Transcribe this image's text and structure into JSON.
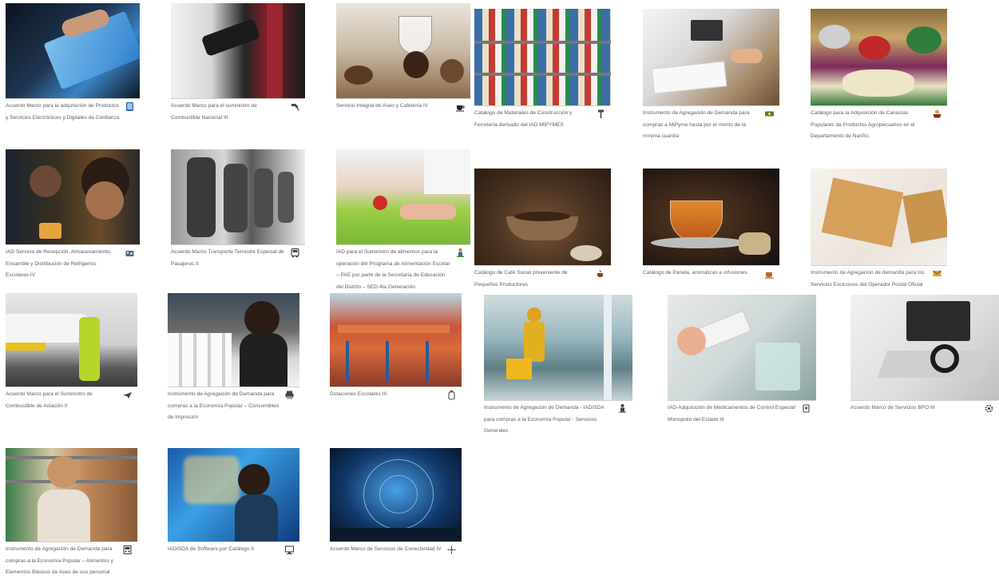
{
  "catalog": {
    "items": [
      {
        "label": "Acuerdo Marco para la adquisición de Productos y Servicios Electrónicos y Digitales de Confianza",
        "icon": "tablet-icon"
      },
      {
        "label": "Acuerdo Marco para el suministro de Combustible Nacional III",
        "icon": "fuel-nozzle-icon"
      },
      {
        "label": "Servicio Integral de Aseo y Cafetería IV",
        "icon": "coffee-cup-icon"
      },
      {
        "label": "Catálogo de Materiales de Construcción y Ferretería derivado del IAD MIPYMES",
        "icon": "hammer-icon"
      },
      {
        "label": "Instrumento de Agregación de Demanda para compras a MiPyme hasta por el monto de la mínima cuantía",
        "icon": "money-icon"
      },
      {
        "label": "Catálogo para la Adquisición de Canastas Populares de Productos Agropecuarios en el Departamento de Nariño.",
        "icon": "basket-icon"
      },
      {
        "label": "IAD Servicio de Recepción, Almacenamiento, Ensamble y Distribución de Refrigerios Escolares IV",
        "icon": "food-tray-icon"
      },
      {
        "label": "Acuerdo Marco Transporte Terrestre Especial de Pasajeros II",
        "icon": "bus-icon"
      },
      {
        "label": "IAD para el Suministro de alimentos para la operación del Programa de Alimentación Escolar – PAE por parte de la Secretaría de Educación del Distrito – SED 4ta Generación",
        "icon": "school-meal-icon"
      },
      {
        "label": "Catálogo de Café Social proveniente de Pequeños Productores",
        "icon": "coffee-icon"
      },
      {
        "label": "Catálogo de Panela, aromáticas e infusiones",
        "icon": "tea-icon"
      },
      {
        "label": "Instrumento de Agregación de demanda para los Servicios Exclusivos del Operador Postal Oficial",
        "icon": "mail-icon"
      },
      {
        "label": "Acuerdo Marco para el Suministro de Combustible de Aviación II",
        "icon": "airplane-icon"
      },
      {
        "label": "Instrumento de Agregación de Demanda para compras a la Economía Popular – Consumibles de Impresión",
        "icon": "printer-icon"
      },
      {
        "label": "Dotaciones Escolares III",
        "icon": "backpack-icon"
      },
      {
        "label": "Instrumento de Agregación de Demanda - IAD/SDA para compras a la Economía Popular - Servicios Generales",
        "icon": "cleaning-icon"
      },
      {
        "label": "IAD-Adquisición de Medicamentos de Control Especial Monopolio del Estado III",
        "icon": "medicine-icon"
      },
      {
        "label": "Acuerdo Marco de Servicios BPO III",
        "icon": "network-gear-icon"
      },
      {
        "label": "Instrumento de Agregación de Demanda para compras a la Economía Popular – Alimentos y Elementos Básicos de Aseo de uso personal",
        "icon": "cash-register-icon"
      },
      {
        "label": "IAD/SDA de Software por Catálogo II",
        "icon": "computer-icon"
      },
      {
        "label": "Acuerdo Marco de Servicios de Conectividad IV",
        "icon": "connectivity-icon"
      }
    ]
  }
}
